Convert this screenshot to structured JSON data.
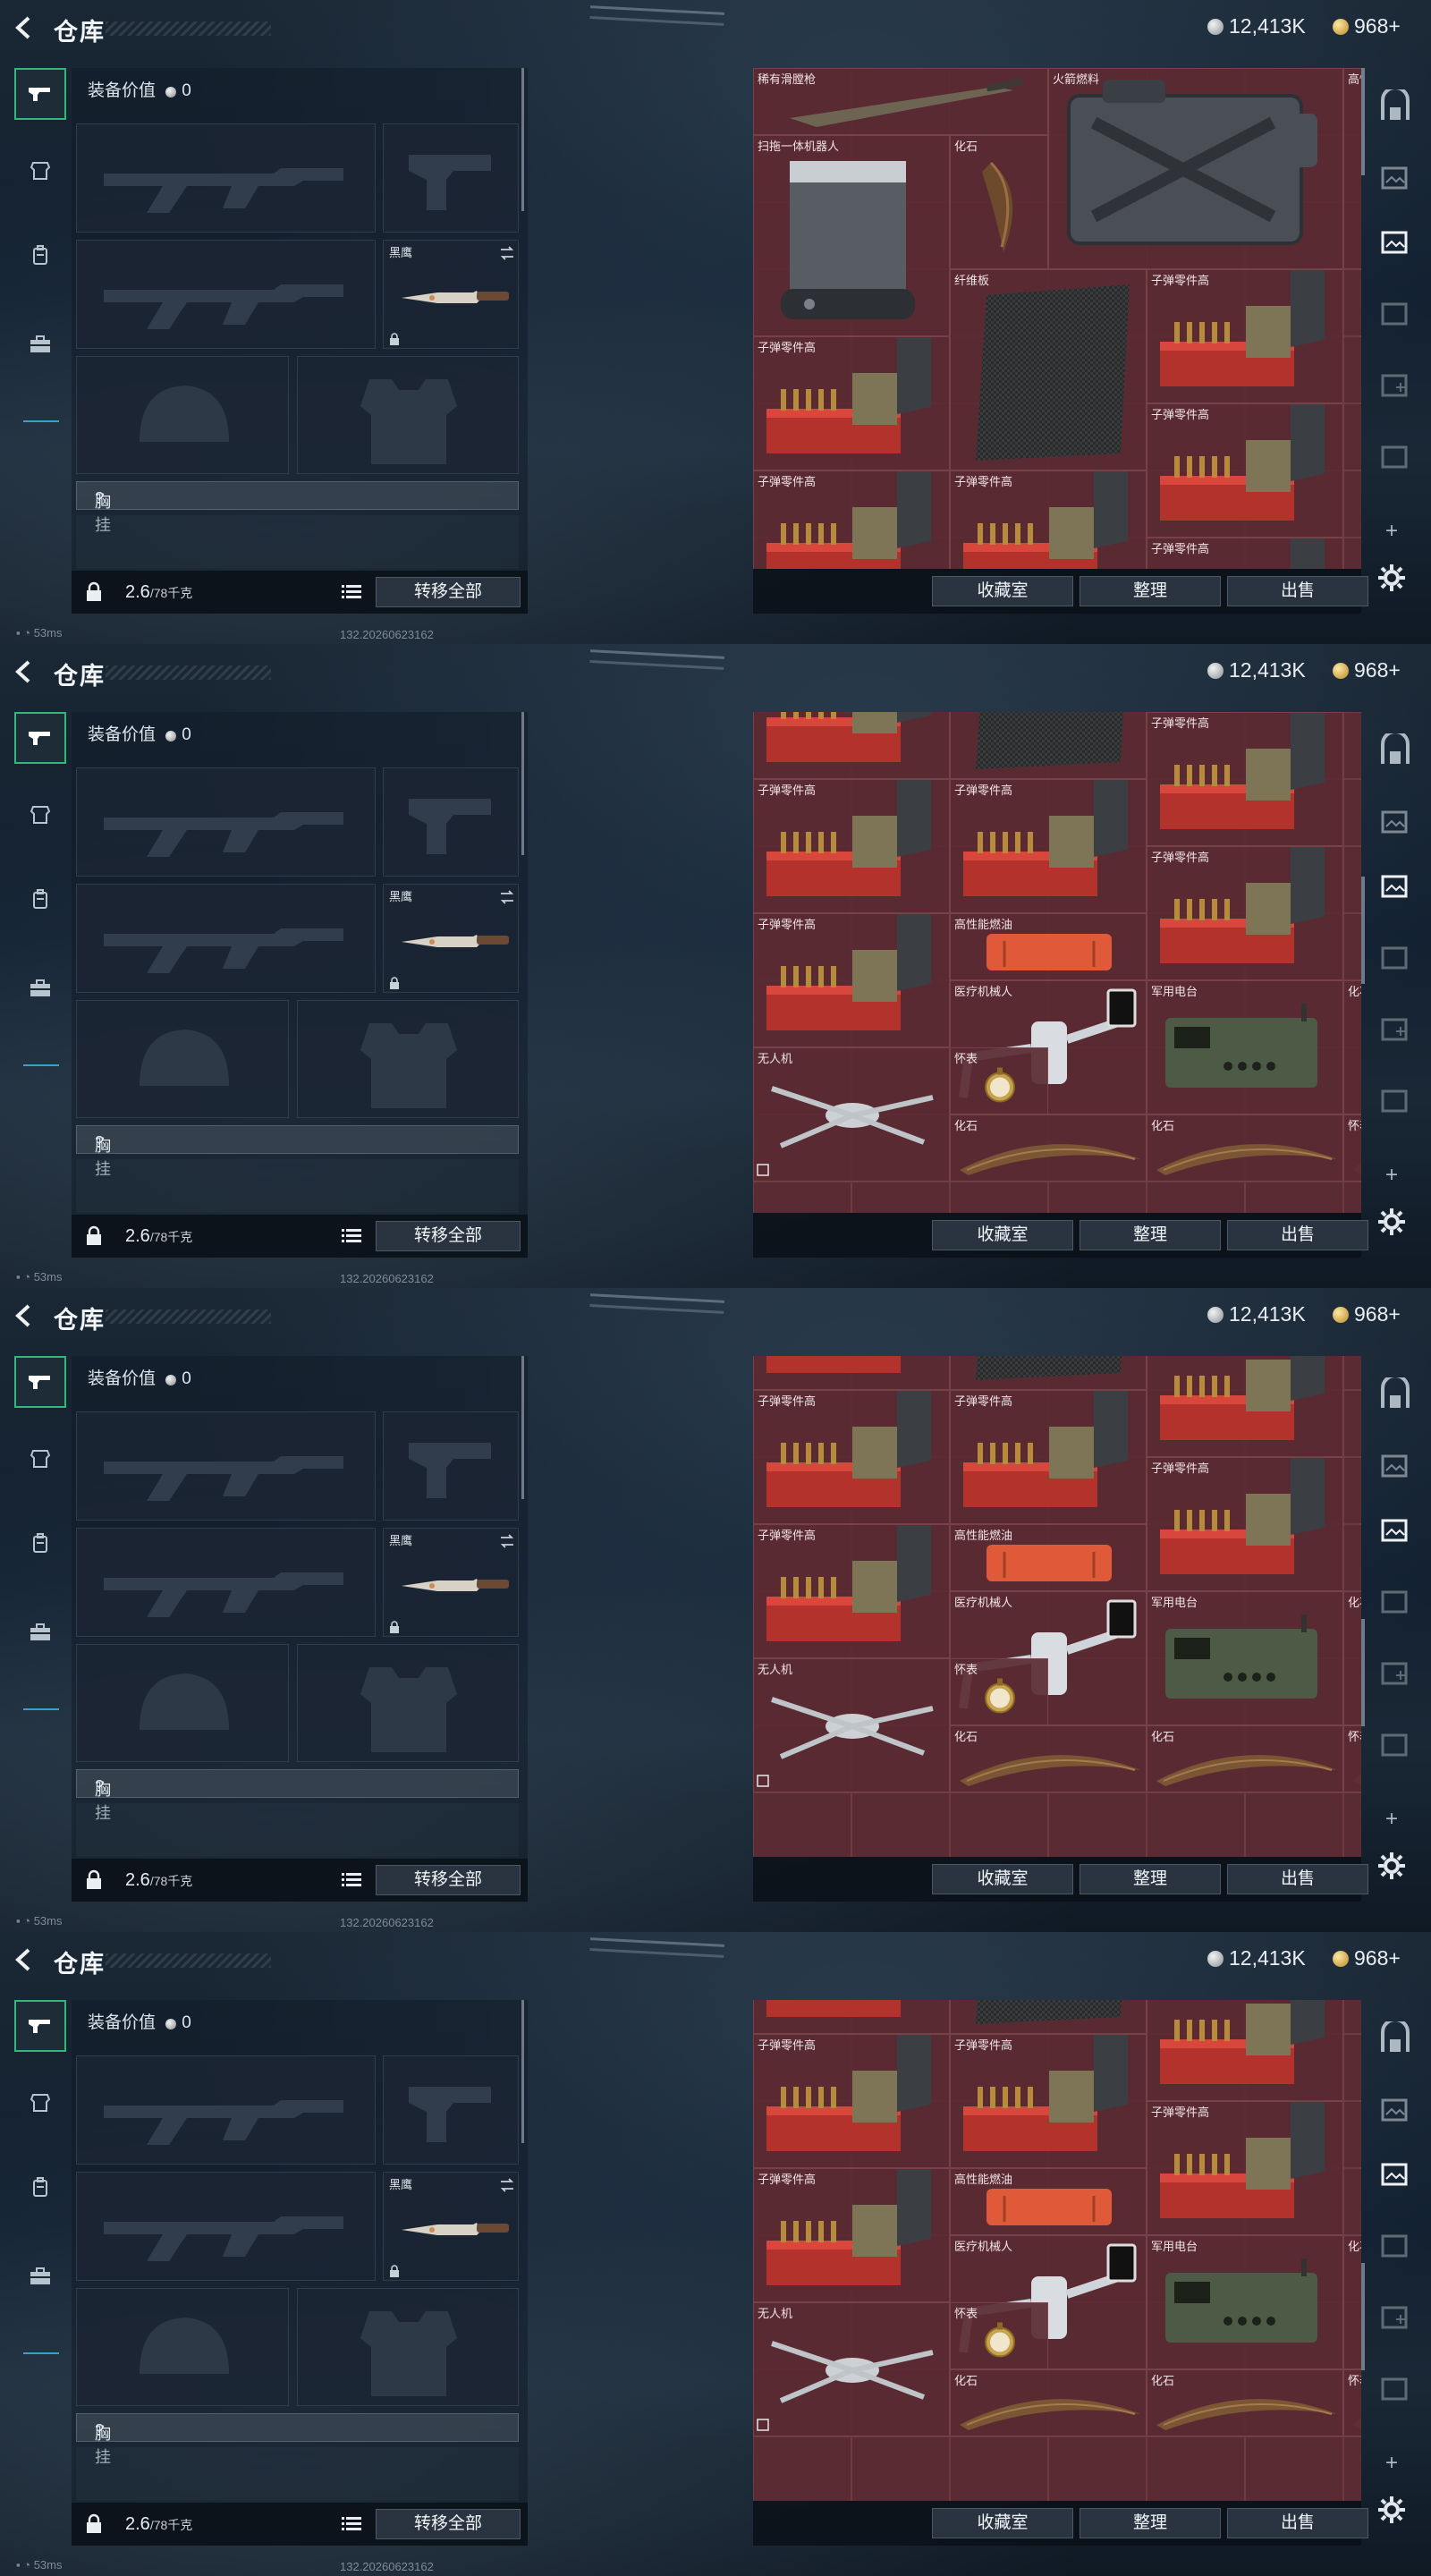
{
  "header": {
    "title": "仓库",
    "silver": "12,413K",
    "gold": "968",
    "gold_suffix": "+"
  },
  "nav": [
    "weapon-icon",
    "armor-icon",
    "backpack-icon",
    "case-icon"
  ],
  "equipment": {
    "value_label": "装备价值",
    "value": "0",
    "melee_label": "黑鹰",
    "chest_label": "胸挂",
    "chest_hint": "?",
    "weight": "2.6",
    "weight_max": "/78千克",
    "transfer_all": "转移全部"
  },
  "inventory_buttons": {
    "collection": "收藏室",
    "sort": "整理",
    "sell": "出售"
  },
  "status": {
    "ping": "53ms",
    "id": "132.20260623162"
  },
  "views": [
    {
      "items": [
        {
          "type": "rifle",
          "label": "稀有滑膛枪",
          "c": 0,
          "r": 0,
          "w": 3,
          "h": 1
        },
        {
          "type": "jerrycan",
          "label": "火箭燃料",
          "c": 3,
          "r": 0,
          "w": 3,
          "h": 3
        },
        {
          "type": "fuel",
          "label": "高性能燃油",
          "c": 6,
          "r": 0,
          "w": 1,
          "h": 3
        },
        {
          "type": "vacuum",
          "label": "扫拖一体机器人",
          "c": 0,
          "r": 1,
          "w": 2,
          "h": 3
        },
        {
          "type": "claw",
          "label": "化石",
          "c": 2,
          "r": 1,
          "w": 1,
          "h": 2
        },
        {
          "type": "carbon",
          "label": "纤维板",
          "c": 2,
          "r": 3,
          "w": 2,
          "h": 3
        },
        {
          "type": "ammo",
          "label": "子弹零件高",
          "c": 4,
          "r": 3,
          "w": 2,
          "h": 2
        },
        {
          "type": "ammo",
          "label": "子弹零件高",
          "c": 0,
          "r": 4,
          "w": 2,
          "h": 2
        },
        {
          "type": "ammo",
          "label": "子弹零件高",
          "c": 4,
          "r": 5,
          "w": 2,
          "h": 2
        },
        {
          "type": "ammo",
          "label": "子弹零件高",
          "c": 0,
          "r": 6,
          "w": 2,
          "h": 2
        },
        {
          "type": "ammo",
          "label": "子弹零件高",
          "c": 2,
          "r": 6,
          "w": 2,
          "h": 2
        },
        {
          "type": "ammo",
          "label": "子弹零件高",
          "c": 4,
          "r": 7,
          "w": 2,
          "h": 2
        }
      ]
    },
    {
      "items": [
        {
          "type": "ammo",
          "label": "",
          "c": 0,
          "r": -1,
          "w": 2,
          "h": 2
        },
        {
          "type": "carbon",
          "label": "",
          "c": 2,
          "r": -2,
          "w": 2,
          "h": 3
        },
        {
          "type": "ammo",
          "label": "子弹零件高",
          "c": 4,
          "r": 0,
          "w": 2,
          "h": 2
        },
        {
          "type": "ammo",
          "label": "子弹零件高",
          "c": 0,
          "r": 1,
          "w": 2,
          "h": 2
        },
        {
          "type": "ammo",
          "label": "子弹零件高",
          "c": 2,
          "r": 1,
          "w": 2,
          "h": 2
        },
        {
          "type": "ammo",
          "label": "子弹零件高",
          "c": 4,
          "r": 2,
          "w": 2,
          "h": 2
        },
        {
          "type": "ammo",
          "label": "子弹零件高",
          "c": 0,
          "r": 3,
          "w": 2,
          "h": 2
        },
        {
          "type": "fuelbox",
          "label": "高性能燃油",
          "c": 2,
          "r": 3,
          "w": 2,
          "h": 1
        },
        {
          "type": "medic",
          "label": "医疗机械人",
          "c": 2,
          "r": 4,
          "w": 2,
          "h": 2
        },
        {
          "type": "radio",
          "label": "军用电台",
          "c": 4,
          "r": 4,
          "w": 2,
          "h": 2
        },
        {
          "type": "claw",
          "label": "化石",
          "c": 6,
          "r": 4,
          "w": 1,
          "h": 2
        },
        {
          "type": "drone",
          "label": "无人机",
          "c": 0,
          "r": 5,
          "w": 2,
          "h": 2
        },
        {
          "type": "watch",
          "label": "怀表",
          "c": 2,
          "r": 5,
          "w": 1,
          "h": 1
        },
        {
          "type": "claw2",
          "label": "化石",
          "c": 2,
          "r": 6,
          "w": 2,
          "h": 1
        },
        {
          "type": "claw2",
          "label": "化石",
          "c": 4,
          "r": 6,
          "w": 2,
          "h": 1
        },
        {
          "type": "claw2",
          "label": "化石",
          "c": 6,
          "r": 6,
          "w": 1,
          "h": 1
        },
        {
          "type": "watch",
          "label": "怀表",
          "c": 6,
          "r": 6,
          "w": 1,
          "h": 1
        }
      ]
    }
  ]
}
